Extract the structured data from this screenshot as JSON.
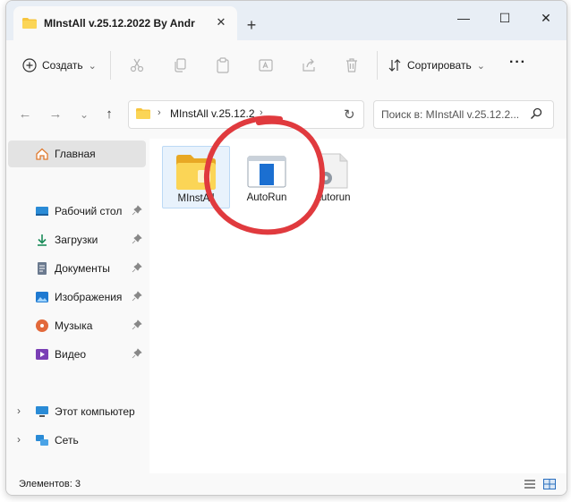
{
  "window": {
    "tab_title": "MInstAll v.25.12.2022 By Andr",
    "tab_close": "✕",
    "new_tab": "+",
    "minimize": "—",
    "maximize": "☐",
    "close": "✕"
  },
  "toolbar": {
    "create_label": "Создать",
    "create_chevron": "⌄",
    "actions": [
      "cut-icon",
      "copy-icon",
      "paste-icon",
      "rename-icon",
      "share-icon",
      "delete-icon"
    ],
    "sort_label": "Сортировать",
    "sort_chevron": "⌄",
    "more": "···"
  },
  "address": {
    "back": "←",
    "forward": "→",
    "recent": "⌄",
    "up": "↑",
    "separator": "›",
    "path": "MInstAll v.25.12.2",
    "chevron": "›",
    "refresh": "↻",
    "search_placeholder": "Поиск в: MInstAll v.25.12.2..."
  },
  "sidebar": {
    "home": "Главная",
    "quick_access": [
      {
        "label": "Рабочий стол",
        "icon": "desktop-icon"
      },
      {
        "label": "Загрузки",
        "icon": "downloads-icon"
      },
      {
        "label": "Документы",
        "icon": "documents-icon"
      },
      {
        "label": "Изображения",
        "icon": "pictures-icon"
      },
      {
        "label": "Музыка",
        "icon": "music-icon"
      },
      {
        "label": "Видео",
        "icon": "video-icon"
      }
    ],
    "expand": "›",
    "this_pc": "Этот компьютер",
    "network": "Сеть"
  },
  "files": [
    {
      "name": "MInstAll",
      "icon": "folder-icon",
      "selected": true
    },
    {
      "name": "AutoRun",
      "icon": "app-icon",
      "selected": false
    },
    {
      "name": "autorun",
      "icon": "settings-file-icon",
      "selected": false
    }
  ],
  "status": {
    "items": "Элементов: 3"
  },
  "colors": {
    "accent": "#0067c0",
    "folder": "#f7c53d",
    "annotation": "#e03a3e",
    "selection": "#e8f2fc"
  }
}
